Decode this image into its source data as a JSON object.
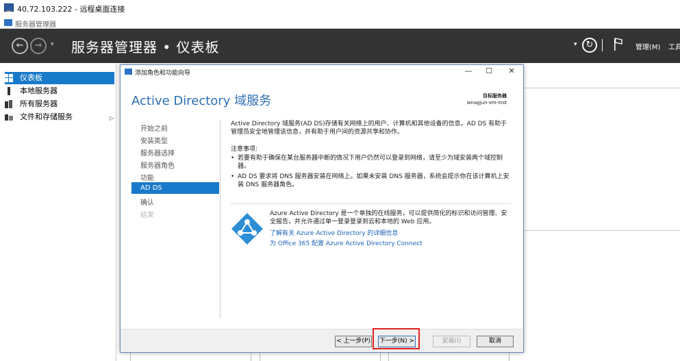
{
  "rdp": {
    "title": "40.72.103.222 - 远程桌面连接"
  },
  "app": {
    "title": "服务器管理器"
  },
  "header": {
    "breadcrumb": "服务器管理器 • 仪表板",
    "back_glyph": "←",
    "forward_glyph": "→",
    "dropdown_glyph": "▾",
    "refresh_glyph": "↻",
    "menu_manage": "管理(M)",
    "menu_tools": "工具(T)"
  },
  "sidebar": {
    "items": [
      {
        "label": "仪表板",
        "icon": "dashboard-icon",
        "active": true
      },
      {
        "label": "本地服务器",
        "icon": "server-icon",
        "active": false
      },
      {
        "label": "所有服务器",
        "icon": "servers-icon",
        "active": false
      },
      {
        "label": "文件和存储服务",
        "icon": "storage-icon",
        "active": false
      }
    ],
    "expand_glyph": "▷"
  },
  "wizard": {
    "title": "添加角色和功能向导",
    "heading": "Active Directory 域服务",
    "target_label": "目标服务器",
    "target_server": "wnagjun-vm-inst",
    "steps": [
      {
        "label": "开始之前",
        "state": "normal"
      },
      {
        "label": "安装类型",
        "state": "normal"
      },
      {
        "label": "服务器选择",
        "state": "normal"
      },
      {
        "label": "服务器角色",
        "state": "normal"
      },
      {
        "label": "功能",
        "state": "normal"
      },
      {
        "label": "AD DS",
        "state": "active"
      },
      {
        "label": "确认",
        "state": "normal"
      },
      {
        "label": "结果",
        "state": "disabled"
      }
    ],
    "description": "Active Directory 域服务(AD DS)存储有关网络上的用户、计算机和其他设备的信息。AD DS 有助于管理员安全地管理该信息，并有助于用户间的资源共享和协作。",
    "notes_title": "注意事项:",
    "notes": [
      "若要有助于确保在某台服务器中断的情况下用户仍然可以登录到网络，请至少为域安装两个域控制器。",
      "AD DS 要求将 DNS 服务器安装在网络上。如果未安装 DNS 服务器，系统会提示你在该计算机上安装 DNS 服务器角色。"
    ],
    "azure_text": "Azure Active Directory 是一个单独的在线服务，可以提供简化的标识和访问管理、安全报告，并允许通过单一登录登录到云和本地的 Web 应用。",
    "azure_link1": "了解有关 Azure Active Directory 的详细信息",
    "azure_link2": "为 Office 365 配置 Azure Active Directory Connect",
    "buttons": {
      "prev": "< 上一步(P)",
      "next": "下一步(N) >",
      "install": "安装(I)",
      "cancel": "取消"
    },
    "window_controls": {
      "minimize": "—",
      "maximize": "☐",
      "close": "✕"
    }
  },
  "colors": {
    "header_bg": "#333333",
    "accent": "#1979ca",
    "heading": "#2d6fb4",
    "link": "#1a62b8",
    "highlight": "#e02020"
  }
}
